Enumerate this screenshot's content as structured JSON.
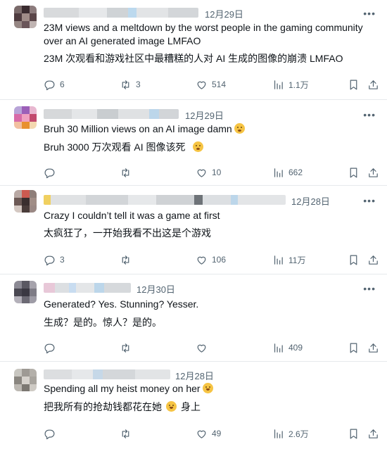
{
  "posts": [
    {
      "date": "12月29日",
      "text": "23M views and a meltdown by the worst people in the gaming community over an AI generated image LMFAO",
      "translation": "23M 次观看和游戏社区中最糟糕的人对 AI 生成的图像的崩溃 LMFAO",
      "emoji": "",
      "translation_emoji": "",
      "translation_after": "",
      "replies": "6",
      "reposts": "3",
      "likes": "514",
      "views": "1.1万"
    },
    {
      "date": "12月29日",
      "text": "Bruh 30 Million views on an AI image damn",
      "translation": "Bruh 3000 万次观看 AI 图像该死",
      "emoji": "astonished-face",
      "translation_emoji": "astonished-face",
      "translation_after": "",
      "replies": "",
      "reposts": "",
      "likes": "10",
      "views": "662"
    },
    {
      "date": "12月28日",
      "text": "Crazy I couldn’t tell it was a game at first",
      "translation": "太疯狂了，一开始我看不出这是个游戏",
      "emoji": "",
      "translation_emoji": "",
      "translation_after": "",
      "replies": "3",
      "reposts": "",
      "likes": "106",
      "views": "11万"
    },
    {
      "date": "12月30日",
      "text": "Generated? Yes. Stunning? Yesser.",
      "translation": "生成？是的。惊人？是的。",
      "emoji": "",
      "translation_emoji": "",
      "translation_after": "",
      "replies": "",
      "reposts": "",
      "likes": "",
      "views": "409"
    },
    {
      "date": "12月28日",
      "text": "Spending all my heist money on her",
      "translation": "把我所有的抢劫钱都花在她",
      "emoji": "smiling-face",
      "translation_emoji": "smiling-face",
      "translation_after": "身上",
      "replies": "",
      "reposts": "",
      "likes": "49",
      "views": "2.6万"
    }
  ],
  "icons": {
    "reply": "reply-icon",
    "repost": "repost-icon",
    "like": "heart-icon",
    "views": "views-icon",
    "bookmark": "bookmark-icon",
    "share": "share-icon",
    "more": "more-icon"
  },
  "colors": {
    "text": "#0f1419",
    "secondary": "#536471",
    "divider": "#e6e9ec"
  }
}
